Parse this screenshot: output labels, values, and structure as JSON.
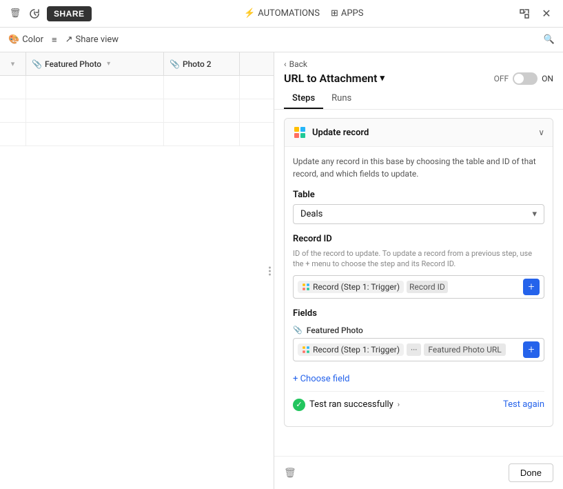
{
  "toolbar": {
    "delete_icon": "🗑",
    "history_icon": "↺",
    "share_btn": "SHARE",
    "automations_label": "AUTOMATIONS",
    "apps_label": "APPS",
    "expand_icon": "⊞",
    "close_icon": "✕"
  },
  "view_toolbar": {
    "color_label": "Color",
    "list_icon": "≡",
    "share_view_label": "Share view",
    "search_icon": "🔍"
  },
  "columns": [
    {
      "label": ""
    },
    {
      "label": "Featured Photo",
      "icon": "📎"
    },
    {
      "label": "Photo 2",
      "icon": "📎"
    }
  ],
  "panel": {
    "back_label": "‹ Back",
    "title": "URL to Attachment",
    "title_caret": "▾",
    "toggle_off": "OFF",
    "toggle_on": "ON",
    "tabs": [
      "Steps",
      "Runs"
    ],
    "active_tab": "Steps",
    "step": {
      "title": "Update record",
      "description": "Update any record in this base by choosing the table and ID of that record, and which fields to update.",
      "table_label": "Table",
      "table_value": "Deals",
      "record_id_label": "Record ID",
      "record_id_sublabel": "ID of the record to update. To update a record from a previous step, use the + menu to choose the step and its Record ID.",
      "trigger_pill": "Record (Step 1: Trigger)",
      "record_id_pill": "Record ID",
      "fields_label": "Fields",
      "featured_photo_field": "Featured Photo",
      "featured_photo_url": "Featured Photo URL",
      "choose_field_label": "+ Choose field",
      "test_label": "Test ran successfully",
      "test_again_label": "Test again",
      "done_label": "Done"
    }
  }
}
